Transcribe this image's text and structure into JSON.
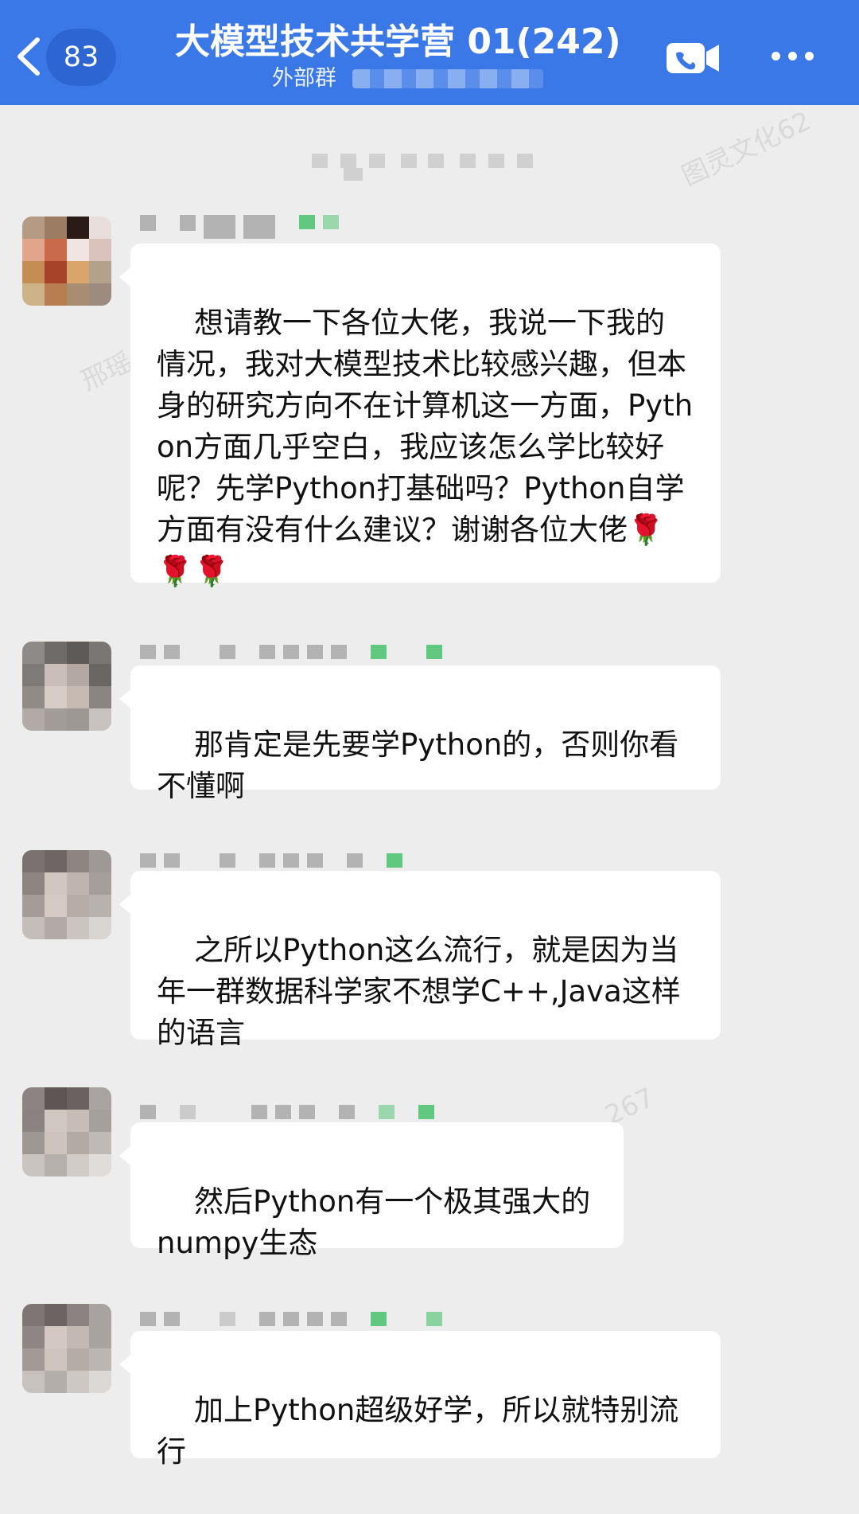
{
  "header": {
    "back_icon": "chevron-left-icon",
    "unread_count": "83",
    "title": "大模型技术共学营 01(242)",
    "subtitle": "外部群",
    "video_icon": "video-camera-icon",
    "more_icon": "more-dots-icon"
  },
  "watermarks": [
    "图灵文化62",
    "邢瑶",
    "267"
  ],
  "messages": [
    {
      "text": "想请教一下各位大佬，我说一下我的情况，我对大模型技术比较感兴趣，但本身的研究方向不在计算机这一方面，Python方面几乎空白，我应该怎么学比较好呢？先学Python打基础吗？Python自学方面有没有什么建议？谢谢各位大佬",
      "emoji": "🌹🌹🌹"
    },
    {
      "text": "那肯定是先要学Python的，否则你看不懂啊"
    },
    {
      "text": "之所以Python这么流行，就是因为当年一群数据科学家不想学C++,Java这样的语言"
    },
    {
      "text": "然后Python有一个极其强大的numpy生态"
    },
    {
      "text": "加上Python超级好学，所以就特别流行"
    }
  ]
}
